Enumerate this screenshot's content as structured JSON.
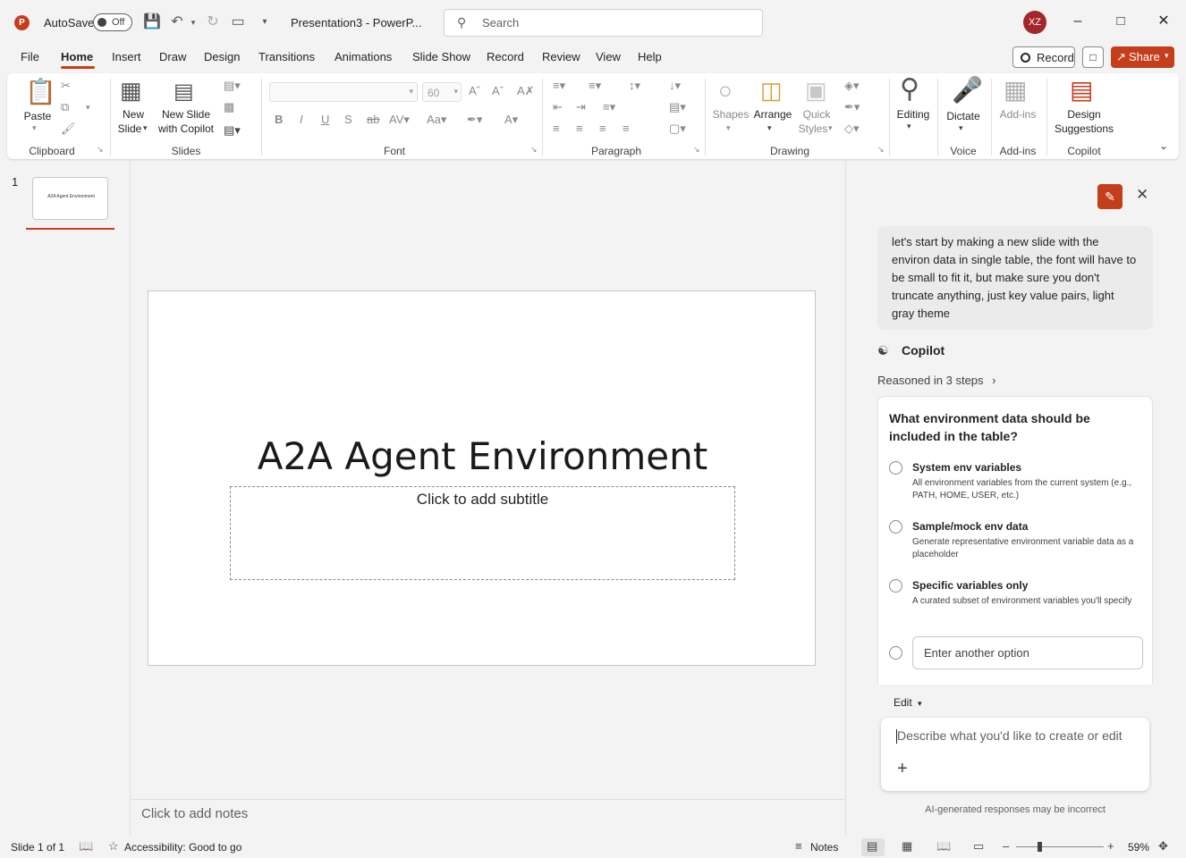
{
  "titlebar": {
    "autosave_label": "AutoSave",
    "autosave_state": "Off",
    "doc_title": "Presentation3 - PowerP...",
    "search_placeholder": "Search",
    "avatar_initials": "XZ"
  },
  "tabs": [
    "File",
    "Home",
    "Insert",
    "Draw",
    "Design",
    "Transitions",
    "Animations",
    "Slide Show",
    "Record",
    "Review",
    "View",
    "Help"
  ],
  "tab_active": "Home",
  "header_actions": {
    "record": "Record",
    "share": "Share"
  },
  "ribbon": {
    "clipboard": {
      "paste": "Paste",
      "label": "Clipboard"
    },
    "slides": {
      "new_slide_1": "New",
      "new_slide_2": "Slide",
      "copilot_1": "New Slide",
      "copilot_2": "with Copilot",
      "label": "Slides"
    },
    "font": {
      "font_size": "60",
      "label": "Font"
    },
    "paragraph": {
      "label": "Paragraph"
    },
    "drawing": {
      "shapes": "Shapes",
      "arrange": "Arrange",
      "quick_1": "Quick",
      "quick_2": "Styles",
      "label": "Drawing"
    },
    "editing": {
      "editing": "Editing"
    },
    "voice": {
      "dictate": "Dictate",
      "label": "Voice"
    },
    "addins": {
      "addins": "Add-ins",
      "label": "Add-ins"
    },
    "copilot": {
      "design_1": "Design",
      "design_2": "Suggestions",
      "label": "Copilot"
    }
  },
  "slides_pane": {
    "slide_number": "1",
    "thumb_title": "A2A Agent Environment"
  },
  "slide": {
    "title": "A2A Agent Environment",
    "subtitle_placeholder": "Click to add subtitle"
  },
  "notes_placeholder": "Click to add notes",
  "copilot": {
    "user_message": "let's start by making a new slide with the environ data in single table, the font will have to be small to fit it, but make sure you don't truncate anything, just key value pairs, light gray theme",
    "name": "Copilot",
    "reasoned": "Reasoned in 3 steps",
    "question": "What environment data should be included in the table?",
    "options": [
      {
        "title": "System env variables",
        "desc": "All environment variables from the current system (e.g., PATH, HOME, USER, etc.)"
      },
      {
        "title": "Sample/mock env data",
        "desc": "Generate representative environment variable data as a placeholder"
      },
      {
        "title": "Specific variables only",
        "desc": "A curated subset of environment variables you'll specify"
      }
    ],
    "other_placeholder": "Enter another option",
    "edit_mode": "Edit",
    "compose_placeholder": "Describe what you'd like to create or edit",
    "disclaimer": "AI-generated responses may be incorrect"
  },
  "status": {
    "slide_info": "Slide 1 of 1",
    "accessibility": "Accessibility: Good to go",
    "notes": "Notes",
    "zoom": "59%"
  },
  "colors": {
    "accent": "#c43e1c",
    "background": "#f3f3f3"
  }
}
